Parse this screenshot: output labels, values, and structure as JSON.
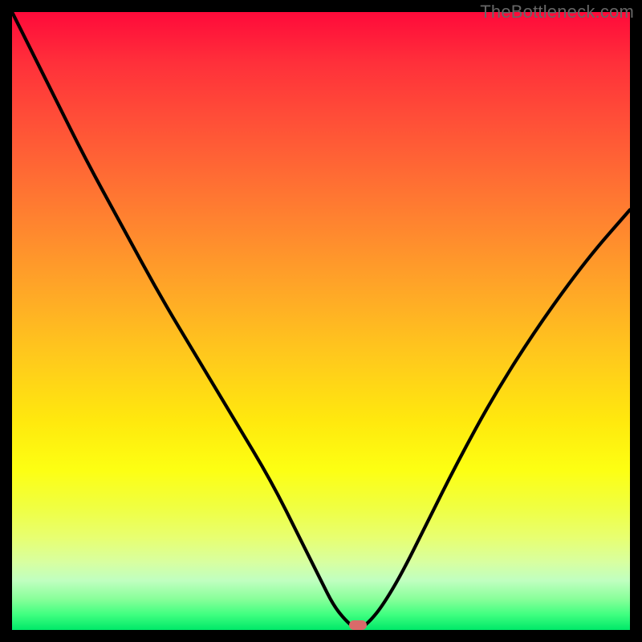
{
  "watermark": "TheBottleneck.com",
  "chart_data": {
    "type": "line",
    "title": "",
    "xlabel": "",
    "ylabel": "",
    "xlim": [
      0,
      100
    ],
    "ylim": [
      0,
      100
    ],
    "x": [
      0,
      3,
      7,
      12,
      18,
      24,
      30,
      36,
      42,
      47,
      50,
      52,
      54,
      55.5,
      56.5,
      58,
      60,
      63,
      67,
      72,
      78,
      85,
      93,
      100
    ],
    "values": [
      100,
      94,
      86,
      76,
      65,
      54,
      44,
      34,
      24,
      14,
      8,
      4,
      1.5,
      0.3,
      0.3,
      1.5,
      4,
      9,
      17,
      27,
      38,
      49,
      60,
      68
    ],
    "minimum_at_x": 56,
    "minimum_marker_color": "#d96a6a",
    "gradient_stops": [
      {
        "pos": 0,
        "color": "#ff0a3a"
      },
      {
        "pos": 50,
        "color": "#ffca1c"
      },
      {
        "pos": 75,
        "color": "#fdff12"
      },
      {
        "pos": 100,
        "color": "#00e868"
      }
    ]
  }
}
